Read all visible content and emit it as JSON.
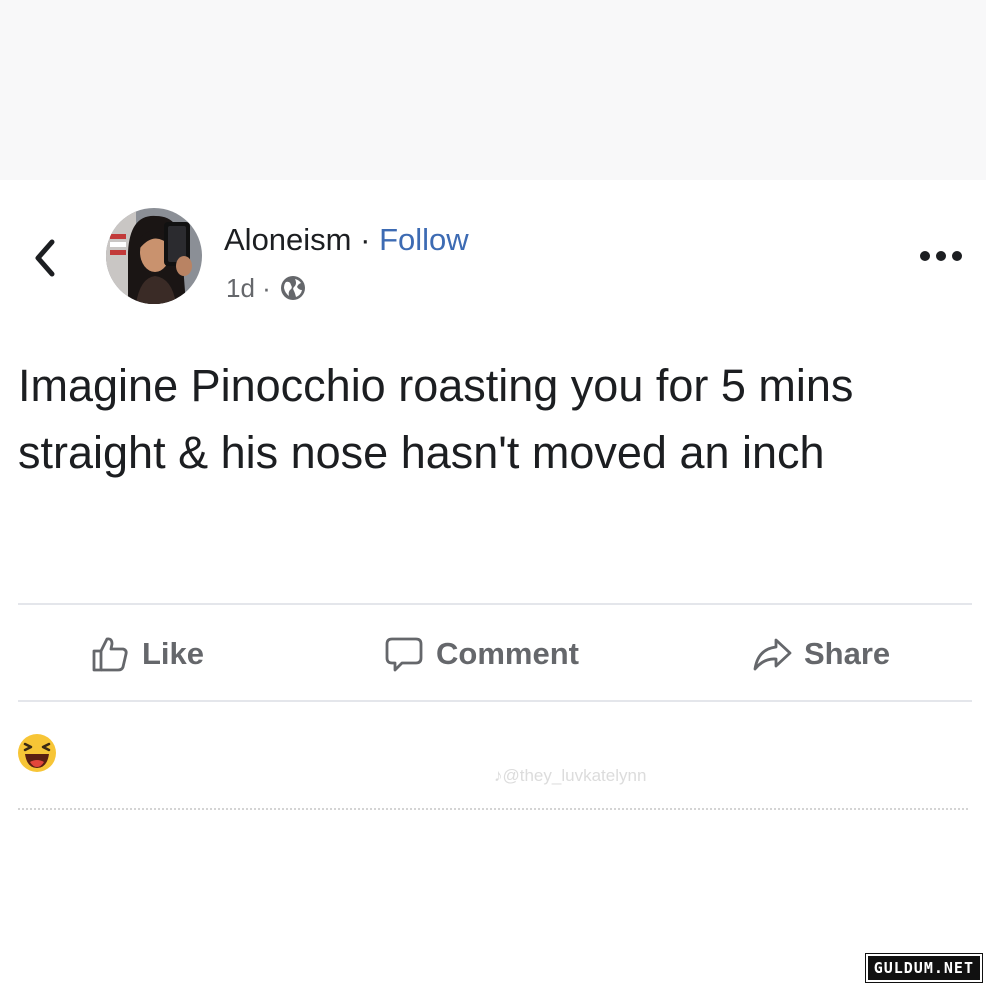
{
  "post": {
    "author": "Aloneism",
    "separator": "·",
    "follow_label": "Follow",
    "time": "1d ·",
    "privacy_icon": "globe-icon",
    "text": "Imagine Pinocchio roasting you for 5 mins straight & his nose hasn't moved an inch"
  },
  "actions": [
    {
      "label": "Like",
      "icon": "thumbs-up-icon"
    },
    {
      "label": "Comment",
      "icon": "comment-bubble-icon"
    },
    {
      "label": "Share",
      "icon": "share-arrow-icon"
    }
  ],
  "reaction": {
    "icon": "laughing-emoji-icon"
  },
  "watermark": "♪@they_luvkatelynn",
  "brand": "GULDUM.NET",
  "colors": {
    "link": "#3d6bb3",
    "text": "#1c1e21",
    "muted": "#65676b",
    "divider": "#e4e6eb",
    "emoji": "#f7c536"
  }
}
